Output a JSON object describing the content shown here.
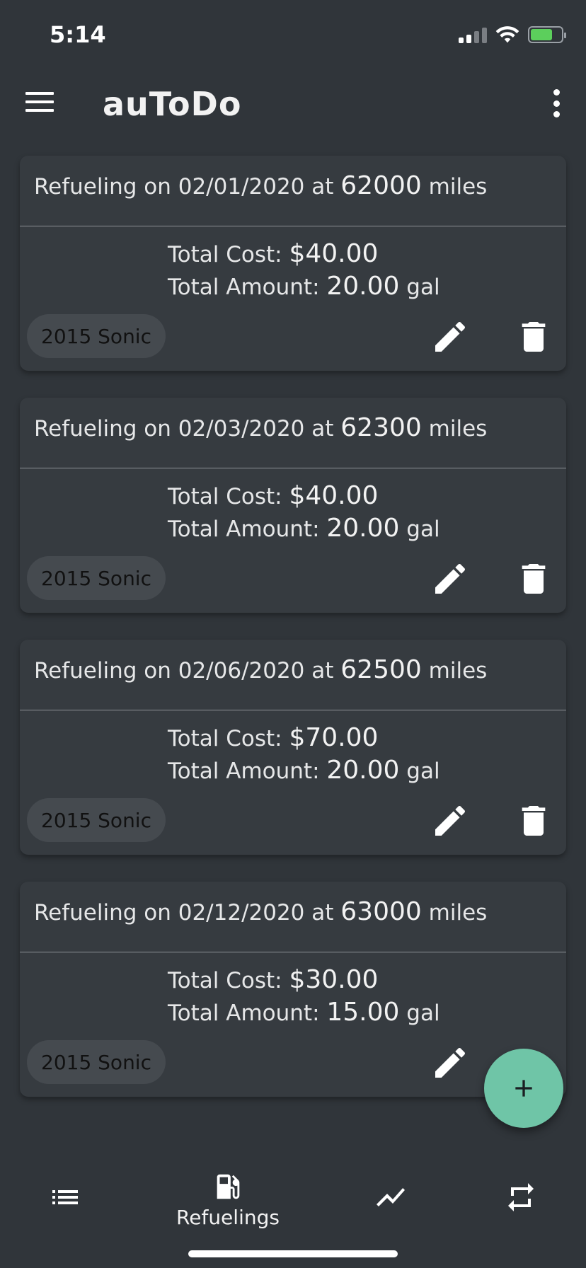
{
  "status_bar": {
    "time": "5:14"
  },
  "app_bar": {
    "title": "auToDo"
  },
  "refuelings": [
    {
      "prefix": "Refueling on ",
      "date": "02/01/2020",
      "at": " at ",
      "mileage": "62000",
      "miles_label": " miles",
      "cost_label": "Total Cost: ",
      "cost": "$40.00",
      "amount_label": "Total Amount: ",
      "amount": "20.00",
      "unit": " gal",
      "car": "2015 Sonic"
    },
    {
      "prefix": "Refueling on ",
      "date": "02/03/2020",
      "at": " at ",
      "mileage": "62300",
      "miles_label": " miles",
      "cost_label": "Total Cost: ",
      "cost": "$40.00",
      "amount_label": "Total Amount: ",
      "amount": "20.00",
      "unit": " gal",
      "car": "2015 Sonic"
    },
    {
      "prefix": "Refueling on ",
      "date": "02/06/2020",
      "at": " at ",
      "mileage": "62500",
      "miles_label": " miles",
      "cost_label": "Total Cost: ",
      "cost": "$70.00",
      "amount_label": "Total Amount: ",
      "amount": "20.00",
      "unit": " gal",
      "car": "2015 Sonic"
    },
    {
      "prefix": "Refueling on ",
      "date": "02/12/2020",
      "at": " at ",
      "mileage": "63000",
      "miles_label": " miles",
      "cost_label": "Total Cost: ",
      "cost": "$30.00",
      "amount_label": "Total Amount: ",
      "amount": "15.00",
      "unit": " gal",
      "car": "2015 Sonic"
    }
  ],
  "bottom_nav": {
    "items": [
      {
        "icon": "list-icon",
        "label": ""
      },
      {
        "icon": "gas-pump-icon",
        "label": "Refuelings"
      },
      {
        "icon": "trending-icon",
        "label": ""
      },
      {
        "icon": "repeat-icon",
        "label": ""
      }
    ]
  },
  "colors": {
    "background": "#30353a",
    "card": "#363b40",
    "fab": "#6fc5a7",
    "chip": "#454a4f"
  }
}
